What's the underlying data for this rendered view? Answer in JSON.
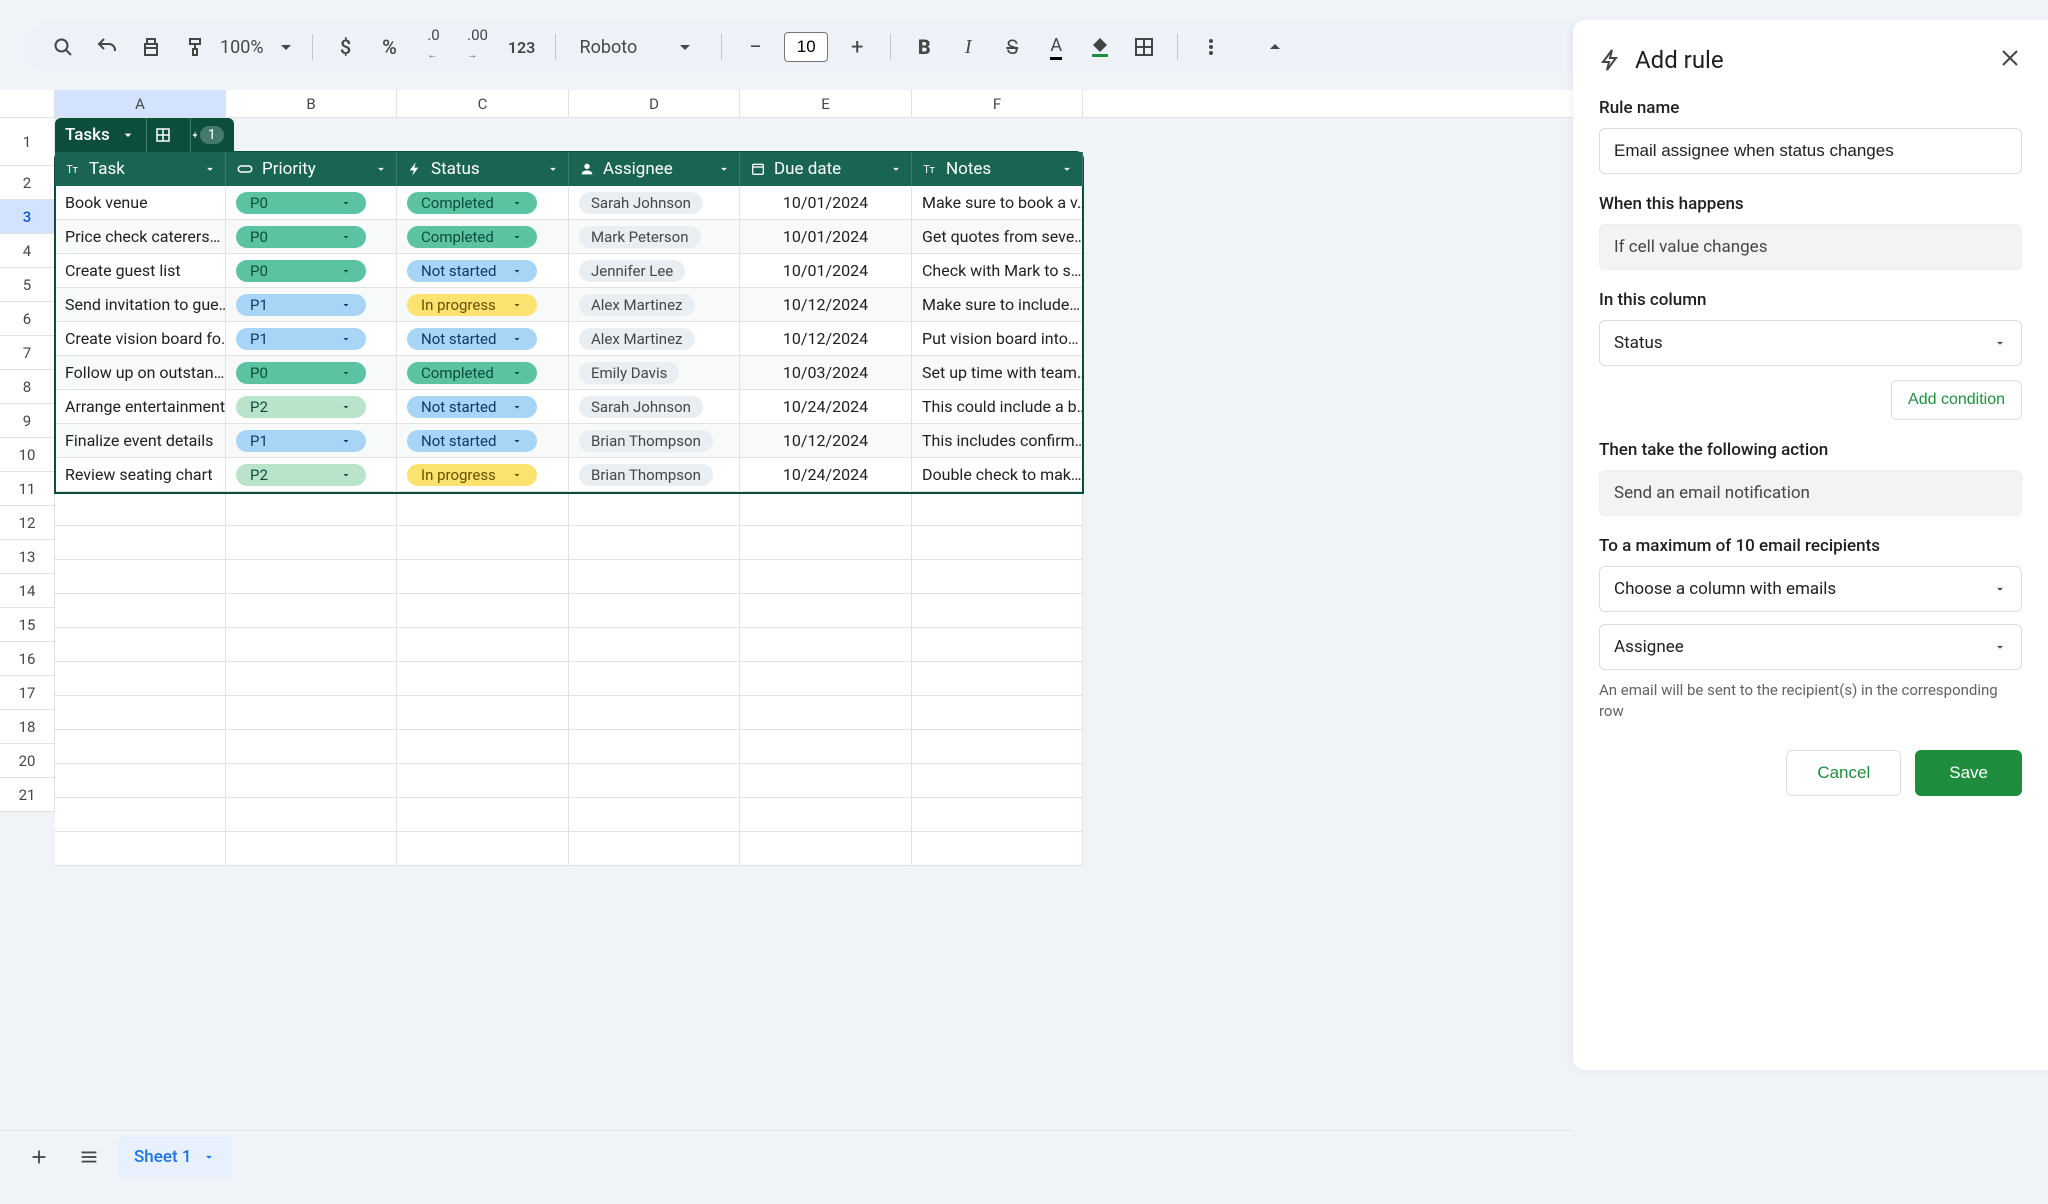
{
  "toolbar": {
    "zoom": "100%",
    "font": "Roboto",
    "fontSize": "10"
  },
  "columns": [
    "A",
    "B",
    "C",
    "D",
    "E",
    "F"
  ],
  "tableChip": {
    "name": "Tasks",
    "badge": "1"
  },
  "headers": {
    "task": "Task",
    "priority": "Priority",
    "status": "Status",
    "assignee": "Assignee",
    "dueDate": "Due date",
    "notes": "Notes"
  },
  "rows": [
    {
      "task": "Book venue",
      "priority": "P0",
      "status": "Completed",
      "assignee": "Sarah Johnson",
      "due": "10/01/2024",
      "notes": "Make sure to book a v…"
    },
    {
      "task": "Price check caterers…",
      "priority": "P0",
      "status": "Completed",
      "assignee": "Mark Peterson",
      "due": "10/01/2024",
      "notes": "Get quotes from seve…"
    },
    {
      "task": "Create guest list",
      "priority": "P0",
      "status": "Not started",
      "assignee": "Jennifer Lee",
      "due": "10/01/2024",
      "notes": "Check with Mark to s…"
    },
    {
      "task": "Send invitation to gue…",
      "priority": "P1",
      "status": "In progress",
      "assignee": "Alex Martinez",
      "due": "10/12/2024",
      "notes": "Make sure to include…"
    },
    {
      "task": "Create vision board fo…",
      "priority": "P1",
      "status": "Not started",
      "assignee": "Alex Martinez",
      "due": "10/12/2024",
      "notes": "Put vision board into…"
    },
    {
      "task": "Follow up on outstan…",
      "priority": "P0",
      "status": "Completed",
      "assignee": "Emily Davis",
      "due": "10/03/2024",
      "notes": "Set up time with team…"
    },
    {
      "task": "Arrange entertainment",
      "priority": "P2",
      "status": "Not started",
      "assignee": "Sarah Johnson",
      "due": "10/24/2024",
      "notes": "This could include a b…"
    },
    {
      "task": "Finalize event details",
      "priority": "P1",
      "status": "Not started",
      "assignee": "Brian Thompson",
      "due": "10/12/2024",
      "notes": "This includes confirm…"
    },
    {
      "task": "Review seating chart",
      "priority": "P2",
      "status": "In progress",
      "assignee": "Brian Thompson",
      "due": "10/24/2024",
      "notes": "Double check to mak…"
    }
  ],
  "rowNums": [
    "1",
    "2",
    "3",
    "4",
    "5",
    "6",
    "7",
    "8",
    "9",
    "10",
    "11",
    "12",
    "13",
    "14",
    "15",
    "16",
    "17",
    "18",
    "20",
    "21"
  ],
  "panel": {
    "title": "Add rule",
    "ruleNameLabel": "Rule name",
    "ruleName": "Email assignee when status changes",
    "whenLabel": "When this happens",
    "whenValue": "If cell value changes",
    "columnLabel": "In this column",
    "columnValue": "Status",
    "addCondition": "Add condition",
    "actionLabel": "Then take the following action",
    "actionValue": "Send an email notification",
    "recipientsLabel": "To a maximum of 10 email recipients",
    "recipientsColumn": "Choose a column with emails",
    "recipientsValue": "Assignee",
    "helper": "An email will be sent to the recipient(s) in the corresponding row",
    "cancel": "Cancel",
    "save": "Save"
  },
  "bottomTabs": {
    "sheet1": "Sheet 1"
  }
}
